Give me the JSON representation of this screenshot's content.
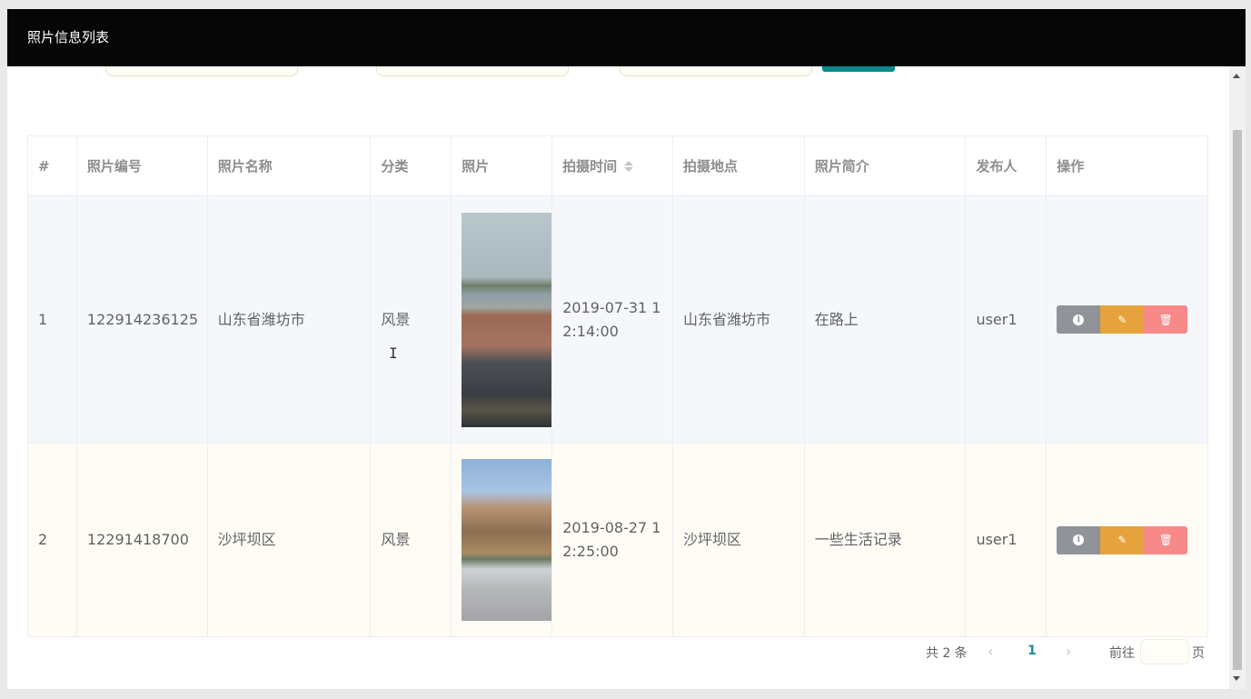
{
  "window": {
    "title": "照片信息列表"
  },
  "table": {
    "columns": [
      "#",
      "照片编号",
      "照片名称",
      "分类",
      "照片",
      "拍摄时间",
      "拍摄地点",
      "照片简介",
      "发布人",
      "操作"
    ],
    "rows": [
      {
        "index": "1",
        "photo_no": "122914236125",
        "photo_name": "山东省潍坊市",
        "category": "风景",
        "shot_time": "2019-07-31 12:14:00",
        "location": "山东省潍坊市",
        "intro": "在路上",
        "publisher": "user1"
      },
      {
        "index": "2",
        "photo_no": "12291418700",
        "photo_name": "沙坪坝区",
        "category": "风景",
        "shot_time": "2019-08-27 12:25:00",
        "location": "沙坪坝区",
        "intro": "一些生活记录",
        "publisher": "user1"
      }
    ],
    "sort_icon": "sort-caret-icon",
    "action_icons": [
      "info-icon",
      "edit-icon",
      "delete-icon"
    ]
  },
  "pagination": {
    "total": "共 2 条",
    "prev": "‹",
    "current_page": "1",
    "next": "›",
    "goto_label": "前往",
    "goto_value": "",
    "page_unit": "页"
  },
  "colors": {
    "titlebar": "#060606",
    "search_button": "#0a8a8e",
    "info_button": "#909399",
    "edit_button": "#e6a23c",
    "delete_button": "#f78989",
    "active_page": "#1a8aa0"
  }
}
